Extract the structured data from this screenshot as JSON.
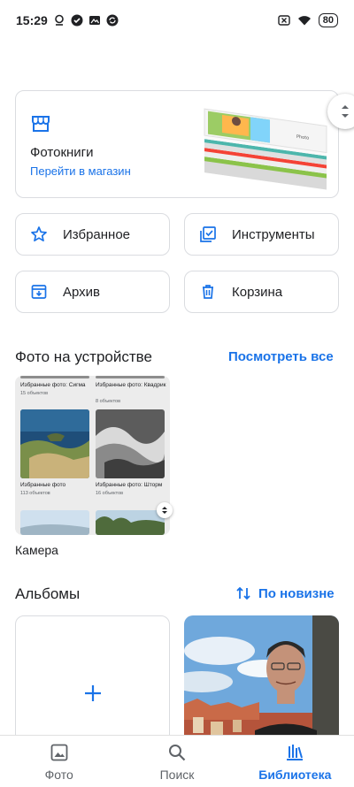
{
  "status_bar": {
    "time": "15:29",
    "battery": "80"
  },
  "photobook": {
    "title": "Фотокниги",
    "link": "Перейти в магазин"
  },
  "quick_actions": [
    {
      "label": "Избранное",
      "icon": "star-icon"
    },
    {
      "label": "Инструменты",
      "icon": "tools-icon"
    },
    {
      "label": "Архив",
      "icon": "archive-icon"
    },
    {
      "label": "Корзина",
      "icon": "trash-icon"
    }
  ],
  "device_photos": {
    "title": "Фото на устройстве",
    "view_all": "Посмотреть все",
    "folder_name": "Камера",
    "thumbs": [
      {
        "caption": "Избранные фото: Сигма",
        "count": "15 объектов"
      },
      {
        "caption": "Избранные фото: Квадрик",
        "count": "8 объектов"
      },
      {
        "caption": "Избранные фото",
        "count": "113 объектов"
      },
      {
        "caption": "Избранные фото: Шторм",
        "count": "16 объектов"
      }
    ]
  },
  "albums": {
    "title": "Альбомы",
    "sort_label": "По новизне"
  },
  "bottom_nav": [
    {
      "label": "Фото",
      "icon": "photo-icon"
    },
    {
      "label": "Поиск",
      "icon": "search-icon"
    },
    {
      "label": "Библиотека",
      "icon": "library-icon",
      "active": true
    }
  ],
  "colors": {
    "accent": "#1a73e8",
    "border": "#dadce0",
    "text": "#202124"
  }
}
